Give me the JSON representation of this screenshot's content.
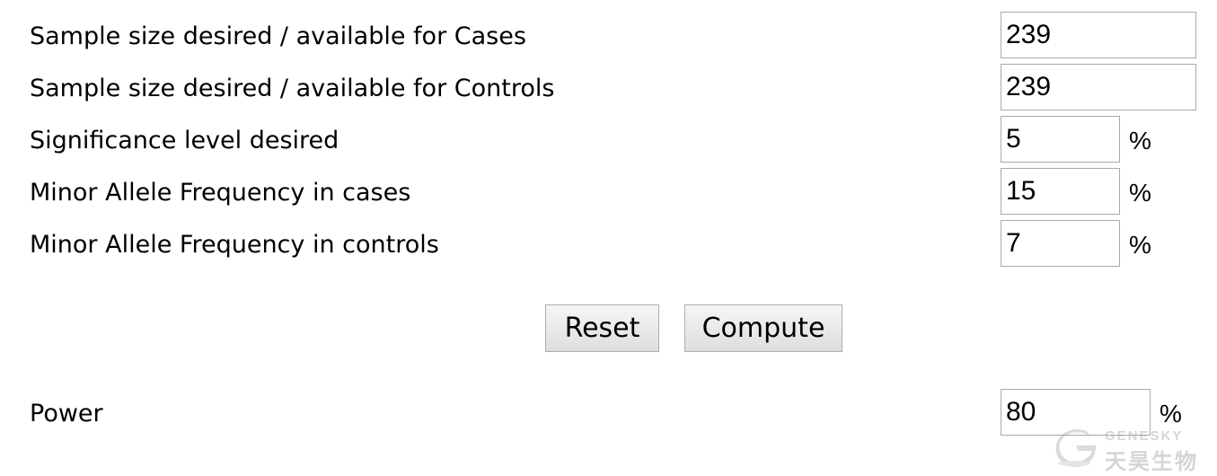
{
  "form": {
    "rows": [
      {
        "label": "Sample size desired / available for Cases",
        "value": "239",
        "unit": ""
      },
      {
        "label": "Sample size desired / available for Controls",
        "value": "239",
        "unit": ""
      },
      {
        "label": "Significance level desired",
        "value": "5",
        "unit": "%"
      },
      {
        "label": "Minor Allele Frequency in cases",
        "value": "15",
        "unit": "%"
      },
      {
        "label": "Minor Allele Frequency in controls",
        "value": "7",
        "unit": "%"
      }
    ]
  },
  "buttons": {
    "reset_label": "Reset",
    "compute_label": "Compute"
  },
  "result": {
    "label": "Power",
    "value": "80",
    "unit": "%"
  },
  "watermark": {
    "brand_en": "GENESKY",
    "brand_cn": "天昊生物"
  }
}
